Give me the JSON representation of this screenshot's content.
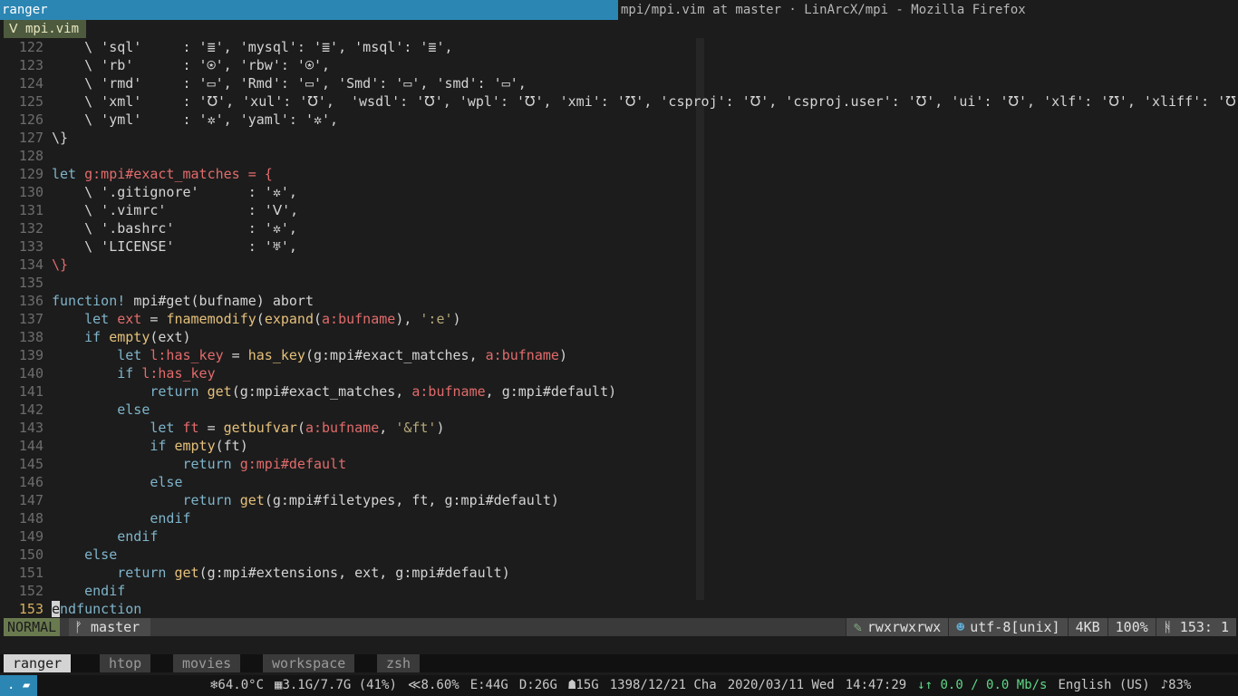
{
  "window": {
    "title_active": "ranger",
    "title_inactive": "mpi/mpi.vim at master · LinArcX/mpi - Mozilla Firefox"
  },
  "vim": {
    "tab_label": "ᐯ mpi.vim",
    "lines": [
      {
        "n": "122",
        "segs": [
          [
            "",
            "    \\ 'sql'     : '≣', 'mysql': '≣', 'msql': '≣',"
          ]
        ]
      },
      {
        "n": "123",
        "segs": [
          [
            "",
            "    \\ 'rb'      : '⍟', 'rbw': '⍟',"
          ]
        ]
      },
      {
        "n": "124",
        "segs": [
          [
            "",
            "    \\ 'rmd'     : '▭', 'Rmd': '▭', 'Smd': '▭', 'smd': '▭',"
          ]
        ]
      },
      {
        "n": "125",
        "segs": [
          [
            "",
            "    \\ 'xml'     : '℧', 'xul': '℧',  'wsdl': '℧', 'wpl': '℧', 'xmi': '℧', 'csproj': '℧', 'csproj.user': '℧', 'ui': '℧', 'xlf': '℧', 'xliff': '℧',"
          ]
        ]
      },
      {
        "n": "126",
        "segs": [
          [
            "",
            "    \\ 'yml'     : '✲', 'yaml': '✲',"
          ]
        ]
      },
      {
        "n": "127",
        "segs": [
          [
            "",
            "\\}"
          ]
        ]
      },
      {
        "n": "128",
        "segs": [
          [
            "",
            ""
          ]
        ]
      },
      {
        "n": "129",
        "segs": [
          [
            "kw",
            "let "
          ],
          [
            "var",
            "g:mpi#exact_matches = {"
          ]
        ]
      },
      {
        "n": "130",
        "segs": [
          [
            "",
            "    \\ '.gitignore'      : '✲',"
          ]
        ]
      },
      {
        "n": "131",
        "segs": [
          [
            "",
            "    \\ '.vimrc'          : 'ᐯ',"
          ]
        ]
      },
      {
        "n": "132",
        "segs": [
          [
            "",
            "    \\ '.bashrc'         : '✲',"
          ]
        ]
      },
      {
        "n": "133",
        "segs": [
          [
            "",
            "    \\ 'LICENSE'         : '♅',"
          ]
        ]
      },
      {
        "n": "134",
        "segs": [
          [
            "var",
            "\\}"
          ]
        ]
      },
      {
        "n": "135",
        "segs": [
          [
            "",
            ""
          ]
        ]
      },
      {
        "n": "136",
        "segs": [
          [
            "kw",
            "function! "
          ],
          [
            "",
            "mpi#get(bufname) abort"
          ]
        ]
      },
      {
        "n": "137",
        "segs": [
          [
            "kw",
            "    let "
          ],
          [
            "var",
            "ext"
          ],
          [
            "",
            " = "
          ],
          [
            "fn",
            "fnamemodify"
          ],
          [
            "",
            "("
          ],
          [
            "fn",
            "expand"
          ],
          [
            "",
            "("
          ],
          [
            "var",
            "a:bufname"
          ],
          [
            "",
            "), "
          ],
          [
            "str",
            "':e'"
          ],
          [
            "",
            ")"
          ]
        ]
      },
      {
        "n": "138",
        "segs": [
          [
            "kw",
            "    if "
          ],
          [
            "fn",
            "empty"
          ],
          [
            "",
            "(ext)"
          ]
        ]
      },
      {
        "n": "139",
        "segs": [
          [
            "kw",
            "        let "
          ],
          [
            "var",
            "l:has_key"
          ],
          [
            "",
            " = "
          ],
          [
            "fn",
            "has_key"
          ],
          [
            "",
            "(g:mpi#exact_matches, "
          ],
          [
            "var",
            "a:bufname"
          ],
          [
            "",
            ")"
          ]
        ]
      },
      {
        "n": "140",
        "segs": [
          [
            "kw",
            "        if "
          ],
          [
            "var",
            "l:has_key"
          ]
        ]
      },
      {
        "n": "141",
        "segs": [
          [
            "kw",
            "            return "
          ],
          [
            "fn",
            "get"
          ],
          [
            "",
            "(g:mpi#exact_matches, "
          ],
          [
            "var",
            "a:bufname"
          ],
          [
            "",
            ", g:mpi#default)"
          ]
        ]
      },
      {
        "n": "142",
        "segs": [
          [
            "kw",
            "        else"
          ]
        ]
      },
      {
        "n": "143",
        "segs": [
          [
            "kw",
            "            let "
          ],
          [
            "var",
            "ft"
          ],
          [
            "",
            " = "
          ],
          [
            "fn",
            "getbufvar"
          ],
          [
            "",
            "("
          ],
          [
            "var",
            "a:bufname"
          ],
          [
            "",
            ", "
          ],
          [
            "str",
            "'&ft'"
          ],
          [
            "",
            ")"
          ]
        ]
      },
      {
        "n": "144",
        "segs": [
          [
            "kw",
            "            if "
          ],
          [
            "fn",
            "empty"
          ],
          [
            "",
            "(ft)"
          ]
        ]
      },
      {
        "n": "145",
        "segs": [
          [
            "kw",
            "                return "
          ],
          [
            "var",
            "g:mpi#default"
          ]
        ]
      },
      {
        "n": "146",
        "segs": [
          [
            "kw",
            "            else"
          ]
        ]
      },
      {
        "n": "147",
        "segs": [
          [
            "kw",
            "                return "
          ],
          [
            "fn",
            "get"
          ],
          [
            "",
            "(g:mpi#filetypes, ft, g:mpi#default)"
          ]
        ]
      },
      {
        "n": "148",
        "segs": [
          [
            "kw",
            "            endif"
          ]
        ]
      },
      {
        "n": "149",
        "segs": [
          [
            "kw",
            "        endif"
          ]
        ]
      },
      {
        "n": "150",
        "segs": [
          [
            "kw",
            "    else"
          ]
        ]
      },
      {
        "n": "151",
        "segs": [
          [
            "kw",
            "        return "
          ],
          [
            "fn",
            "get"
          ],
          [
            "",
            "(g:mpi#extensions, ext, g:mpi#default)"
          ]
        ]
      },
      {
        "n": "152",
        "segs": [
          [
            "kw",
            "    endif"
          ]
        ]
      },
      {
        "n": "153",
        "segs": [
          [
            "cursor",
            "e"
          ],
          [
            "kw",
            "ndfunction"
          ]
        ],
        "current": true
      }
    ],
    "statusline": {
      "mode": "NORMAL",
      "branch": "ᚠ master",
      "permissions": "rwxrwxrwx",
      "encoding": "utf-8[unix]",
      "size": "4KB",
      "percent": "100%",
      "position": "ᚻ 153:  1"
    }
  },
  "tmux": {
    "windows": [
      "ranger",
      "htop",
      "movies",
      "workspace",
      "zsh"
    ],
    "active": "ranger"
  },
  "sysbar": {
    "workspace_icon": ". ▰",
    "items": [
      "❄64.0°C",
      "▦3.1G/7.7G (41%)",
      "≪8.60%",
      "E:44G",
      "D:26G",
      "☗15G",
      "1398/12/21 Cha",
      "2020/03/11 Wed",
      "14:47:29"
    ],
    "net": "↓↑  0.0  /  0.0 Mb/s",
    "keyboard": "English (US)",
    "volume": "♪83%"
  }
}
